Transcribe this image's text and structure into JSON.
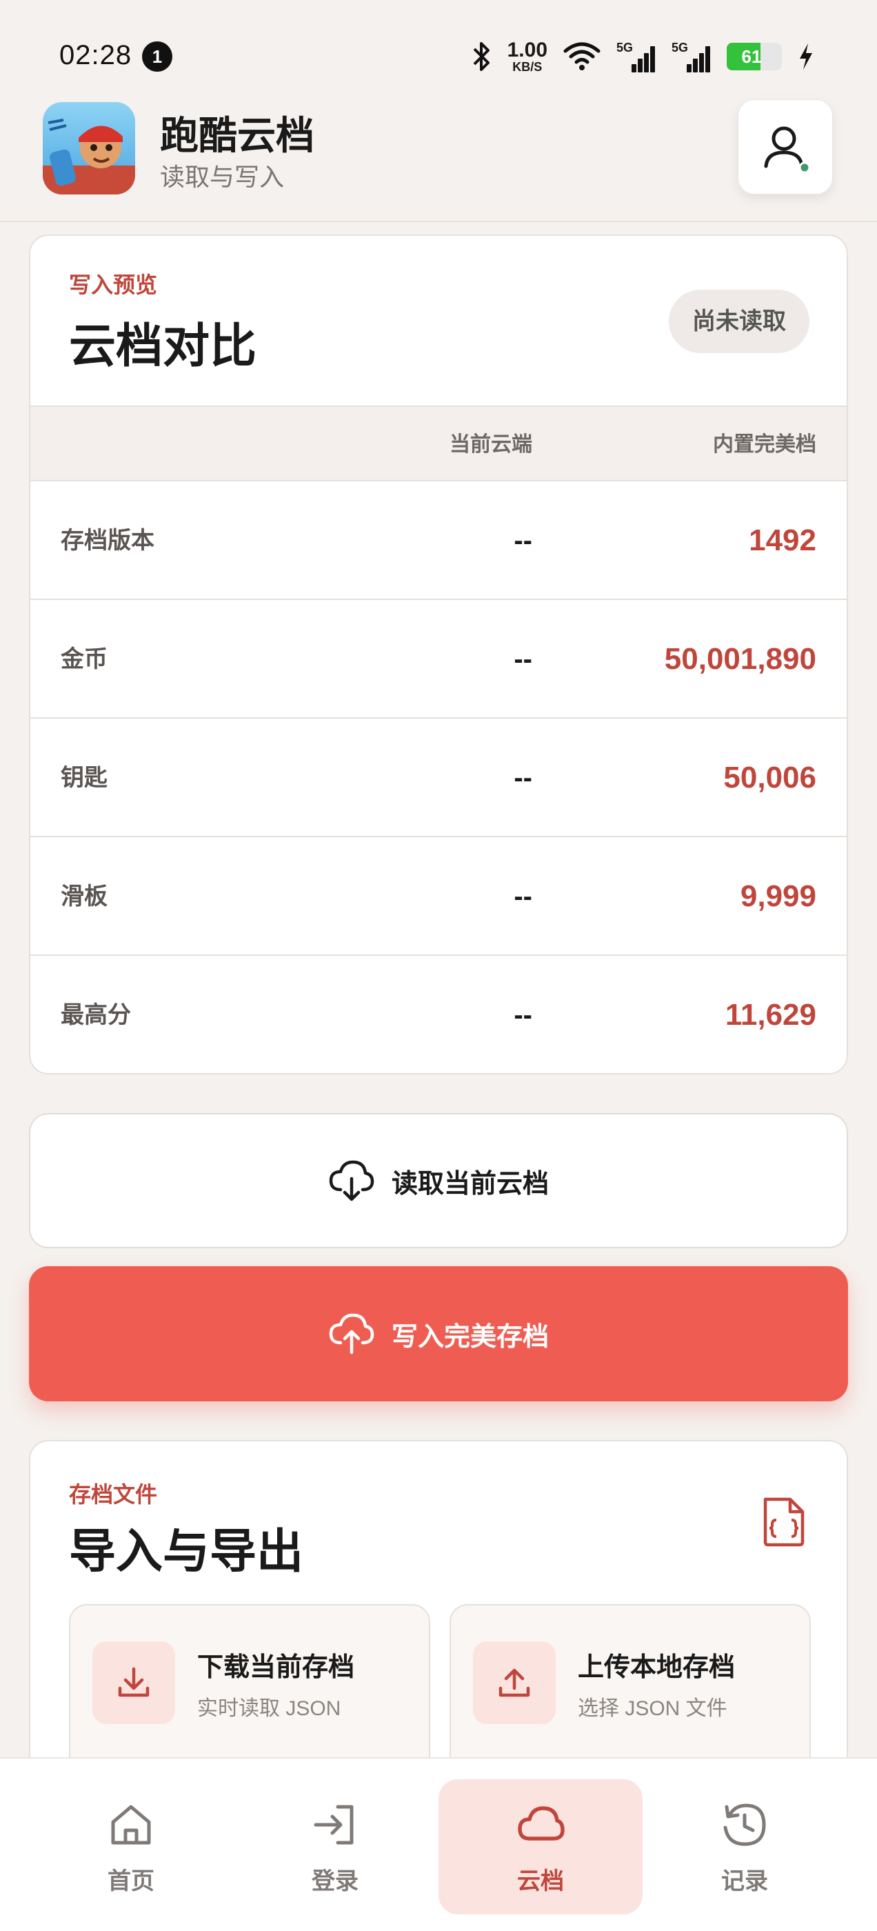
{
  "status_bar": {
    "time": "02:28",
    "notification_count": "1",
    "net_speed_value": "1.00",
    "net_speed_unit": "KB/S",
    "signal_1_label": "5G",
    "signal_2_label": "5G",
    "battery_level": "61",
    "battery_fraction": 0.61
  },
  "header": {
    "app_title": "跑酷云档",
    "app_subtitle": "读取与写入",
    "account_icon": "user-icon"
  },
  "compare": {
    "eyebrow": "写入预览",
    "title": "云档对比",
    "status_chip": "尚未读取",
    "col_current": "当前云端",
    "col_perfect": "内置完美档",
    "rows": [
      {
        "label": "存档版本",
        "current": "--",
        "perfect": "1492"
      },
      {
        "label": "金币",
        "current": "--",
        "perfect": "50,001,890"
      },
      {
        "label": "钥匙",
        "current": "--",
        "perfect": "50,006"
      },
      {
        "label": "滑板",
        "current": "--",
        "perfect": "9,999"
      },
      {
        "label": "最高分",
        "current": "--",
        "perfect": "11,629"
      }
    ]
  },
  "actions": {
    "read_label": "读取当前云档",
    "read_icon": "cloud-download-icon",
    "write_label": "写入完美存档",
    "write_icon": "cloud-upload-icon"
  },
  "files": {
    "eyebrow": "存档文件",
    "title": "导入与导出",
    "header_icon": "json-file-icon",
    "download_title": "下载当前存档",
    "download_sub": "实时读取 JSON",
    "upload_title": "上传本地存档",
    "upload_sub": "选择 JSON 文件"
  },
  "nav": {
    "items": [
      {
        "label": "首页",
        "icon": "home-icon"
      },
      {
        "label": "登录",
        "icon": "login-icon"
      },
      {
        "label": "云档",
        "icon": "cloud-icon",
        "active": true
      },
      {
        "label": "记录",
        "icon": "history-icon"
      }
    ]
  },
  "colors": {
    "accent": "#c0463c",
    "primary_button": "#ef5d52",
    "background": "#f5f1ee"
  }
}
